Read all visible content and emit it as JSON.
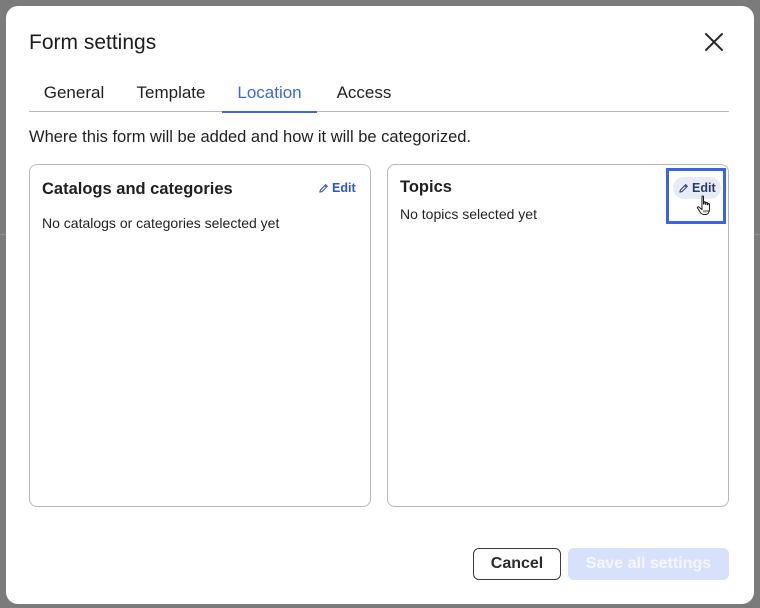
{
  "dialog": {
    "title": "Form settings",
    "close_icon": "close-icon",
    "tabs": [
      {
        "label": "General",
        "active": false
      },
      {
        "label": "Template",
        "active": false
      },
      {
        "label": "Location",
        "active": true
      },
      {
        "label": "Access",
        "active": false
      }
    ],
    "description": "Where this form will be added and how it will be categorized."
  },
  "cards": [
    {
      "title": "Catalogs and categories",
      "empty_text": "No catalogs or categories selected yet",
      "edit_label": "Edit",
      "edit_icon": "pencil-icon"
    },
    {
      "title": "Topics",
      "empty_text": "No topics selected yet",
      "edit_label": "Edit",
      "edit_icon": "pencil-icon",
      "highlighted": true
    }
  ],
  "footer": {
    "cancel_label": "Cancel",
    "save_label": "Save all settings",
    "save_disabled": true
  },
  "colors": {
    "accent": "#3d67d6",
    "focus_ring": "#3c62e6",
    "save_disabled_bg": "#d7e1fb"
  },
  "pointer_icon": "hand-pointer-icon"
}
